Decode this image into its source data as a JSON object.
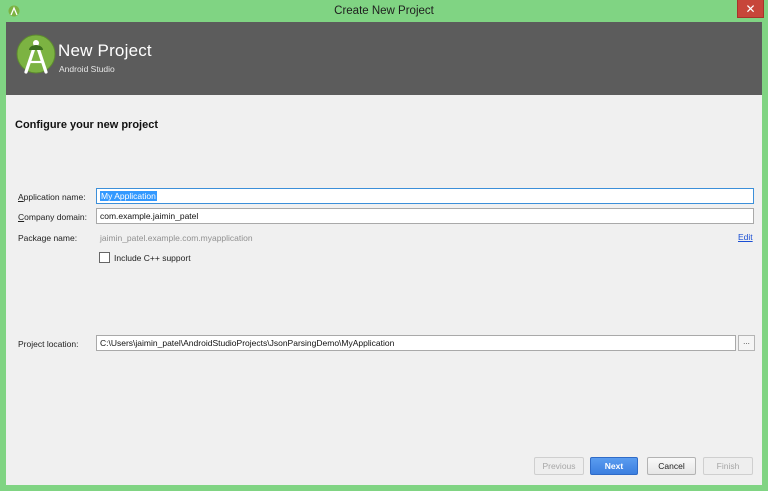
{
  "window": {
    "title": "Create New Project",
    "close_glyph": "✕"
  },
  "header": {
    "title": "New Project",
    "subtitle": "Android Studio"
  },
  "section": {
    "title": "Configure your new project"
  },
  "form": {
    "app_name": {
      "label_prefix": "A",
      "label_rest": "pplication name:",
      "value": "My Application"
    },
    "company_domain": {
      "label_prefix": "C",
      "label_rest": "ompany domain:",
      "value": "com.example.jaimin_patel"
    },
    "package_name": {
      "label": "Package name:",
      "value": "jaimin_patel.example.com.myapplication",
      "edit_label": "Edit"
    },
    "cpp_support": {
      "label": "Include C++ support",
      "checked": false
    },
    "project_location": {
      "label": "Project location:",
      "value": "C:\\Users\\jaimin_patel\\AndroidStudioProjects\\JsonParsingDemo\\MyApplication",
      "browse_label": "..."
    }
  },
  "buttons": {
    "previous": "Previous",
    "next": "Next",
    "cancel": "Cancel",
    "finish": "Finish"
  },
  "colors": {
    "frame": "#80d483",
    "header_bg": "#5c5c5c",
    "primary_button": "#3c7fe0",
    "link": "#1a4fd4",
    "android_green": "#7cb342"
  }
}
